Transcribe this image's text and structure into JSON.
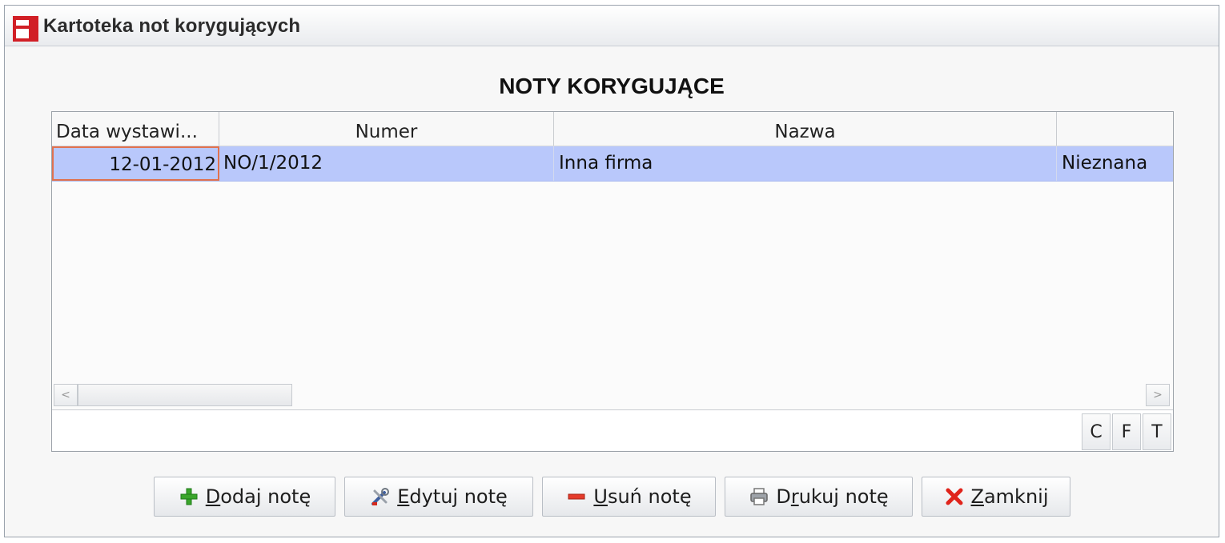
{
  "window": {
    "title": "Kartoteka not korygujących"
  },
  "heading": "NOTY KORYGUJĄCE",
  "table": {
    "columns": [
      "Data wystawi...",
      "Numer",
      "Nazwa",
      ""
    ],
    "rows": [
      {
        "date": "12-01-2012",
        "number": "NO/1/2012",
        "name": "Inna firma",
        "extra": "Nieznana"
      }
    ]
  },
  "scrollbar": {
    "left_arrow": "<",
    "right_arrow": ">"
  },
  "filter_buttons": [
    "C",
    "F",
    "T"
  ],
  "actions": {
    "add": {
      "mnemonic": "D",
      "rest": "odaj notę"
    },
    "edit": {
      "mnemonic": "E",
      "rest": "dytuj notę"
    },
    "delete": {
      "mnemonic": "U",
      "rest": "suń notę"
    },
    "print": {
      "pre": "D",
      "mnemonic": "r",
      "rest": "ukuj notę"
    },
    "close": {
      "mnemonic": "Z",
      "rest": "amknij"
    }
  },
  "colors": {
    "selection": "#b9c8fb",
    "focus_border": "#e0714f",
    "logo_red": "#d11f26"
  }
}
